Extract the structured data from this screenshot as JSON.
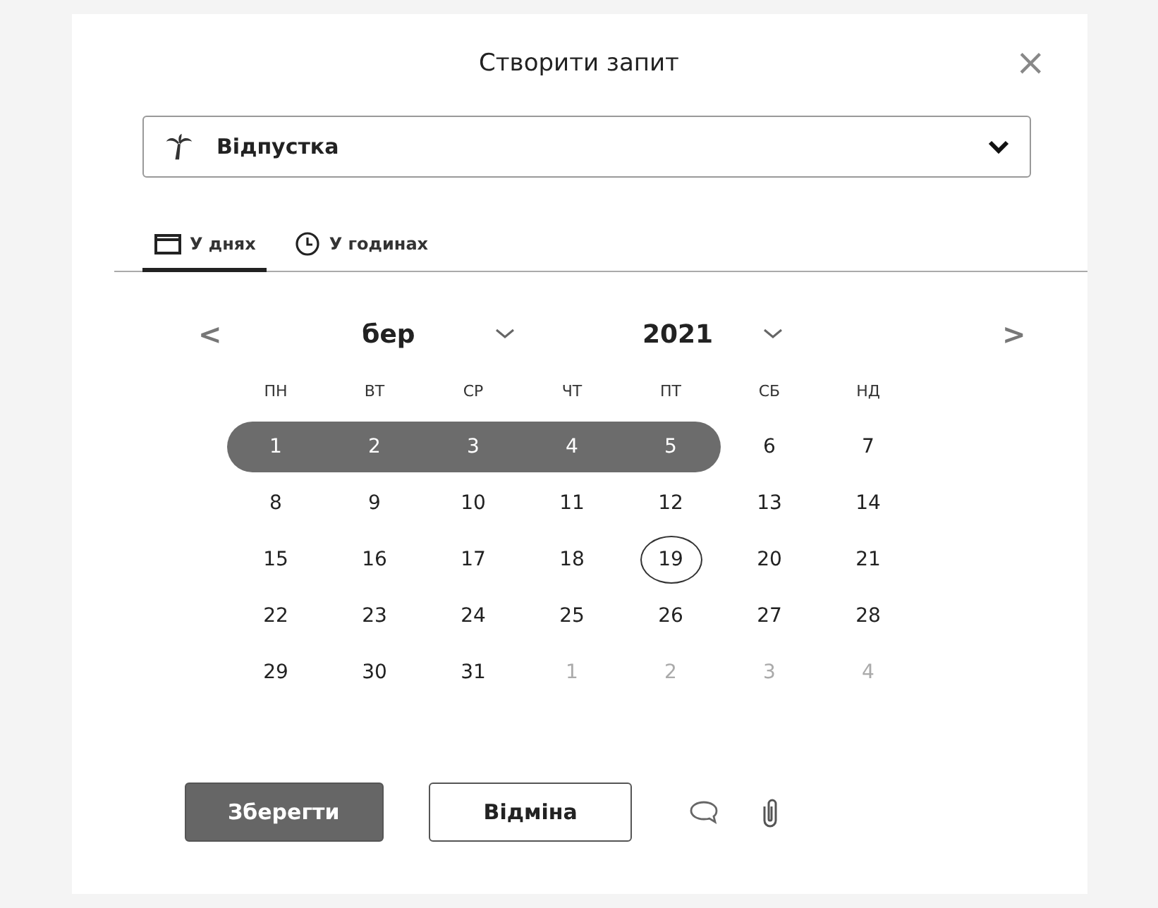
{
  "dialog": {
    "title": "Створити запит",
    "close": "×"
  },
  "type_select": {
    "value": "Відпустка"
  },
  "tabs": [
    {
      "label": "У днях",
      "kind": "days",
      "selected": true
    },
    {
      "label": "У годинах",
      "kind": "hours",
      "selected": false
    }
  ],
  "calendar": {
    "prev": "<",
    "month": "бер",
    "year": "2021",
    "next": ">",
    "weekdays": [
      "ПН",
      "ВТ",
      "СР",
      "ЧТ",
      "ПТ",
      "СБ",
      "НД"
    ],
    "days": [
      {
        "day": "1",
        "selected": true,
        "today": false,
        "outside": false
      },
      {
        "day": "2",
        "selected": true,
        "today": false,
        "outside": false
      },
      {
        "day": "3",
        "selected": true,
        "today": false,
        "outside": false
      },
      {
        "day": "4",
        "selected": true,
        "today": false,
        "outside": false
      },
      {
        "day": "5",
        "selected": true,
        "today": false,
        "outside": false
      },
      {
        "day": "6",
        "selected": false,
        "today": false,
        "outside": false
      },
      {
        "day": "7",
        "selected": false,
        "today": false,
        "outside": false
      },
      {
        "day": "8",
        "selected": false,
        "today": false,
        "outside": false
      },
      {
        "day": "9",
        "selected": false,
        "today": false,
        "outside": false
      },
      {
        "day": "10",
        "selected": false,
        "today": false,
        "outside": false
      },
      {
        "day": "11",
        "selected": false,
        "today": false,
        "outside": false
      },
      {
        "day": "12",
        "selected": false,
        "today": false,
        "outside": false
      },
      {
        "day": "13",
        "selected": false,
        "today": false,
        "outside": false
      },
      {
        "day": "14",
        "selected": false,
        "today": false,
        "outside": false
      },
      {
        "day": "15",
        "selected": false,
        "today": false,
        "outside": false
      },
      {
        "day": "16",
        "selected": false,
        "today": false,
        "outside": false
      },
      {
        "day": "17",
        "selected": false,
        "today": false,
        "outside": false
      },
      {
        "day": "18",
        "selected": false,
        "today": false,
        "outside": false
      },
      {
        "day": "19",
        "selected": false,
        "today": true,
        "outside": false
      },
      {
        "day": "20",
        "selected": false,
        "today": false,
        "outside": false
      },
      {
        "day": "21",
        "selected": false,
        "today": false,
        "outside": false
      },
      {
        "day": "22",
        "selected": false,
        "today": false,
        "outside": false
      },
      {
        "day": "23",
        "selected": false,
        "today": false,
        "outside": false
      },
      {
        "day": "24",
        "selected": false,
        "today": false,
        "outside": false
      },
      {
        "day": "25",
        "selected": false,
        "today": false,
        "outside": false
      },
      {
        "day": "26",
        "selected": false,
        "today": false,
        "outside": false
      },
      {
        "day": "27",
        "selected": false,
        "today": false,
        "outside": false
      },
      {
        "day": "28",
        "selected": false,
        "today": false,
        "outside": false
      },
      {
        "day": "29",
        "selected": false,
        "today": false,
        "outside": false
      },
      {
        "day": "30",
        "selected": false,
        "today": false,
        "outside": false
      },
      {
        "day": "31",
        "selected": false,
        "today": false,
        "outside": false
      },
      {
        "day": "1",
        "selected": false,
        "today": false,
        "outside": true
      },
      {
        "day": "2",
        "selected": false,
        "today": false,
        "outside": true
      },
      {
        "day": "3",
        "selected": false,
        "today": false,
        "outside": true
      },
      {
        "day": "4",
        "selected": false,
        "today": false,
        "outside": true
      }
    ]
  },
  "buttons": [
    {
      "label": "Зберегти",
      "kind": "primary"
    },
    {
      "label": "Відміна",
      "kind": "secondary"
    }
  ]
}
